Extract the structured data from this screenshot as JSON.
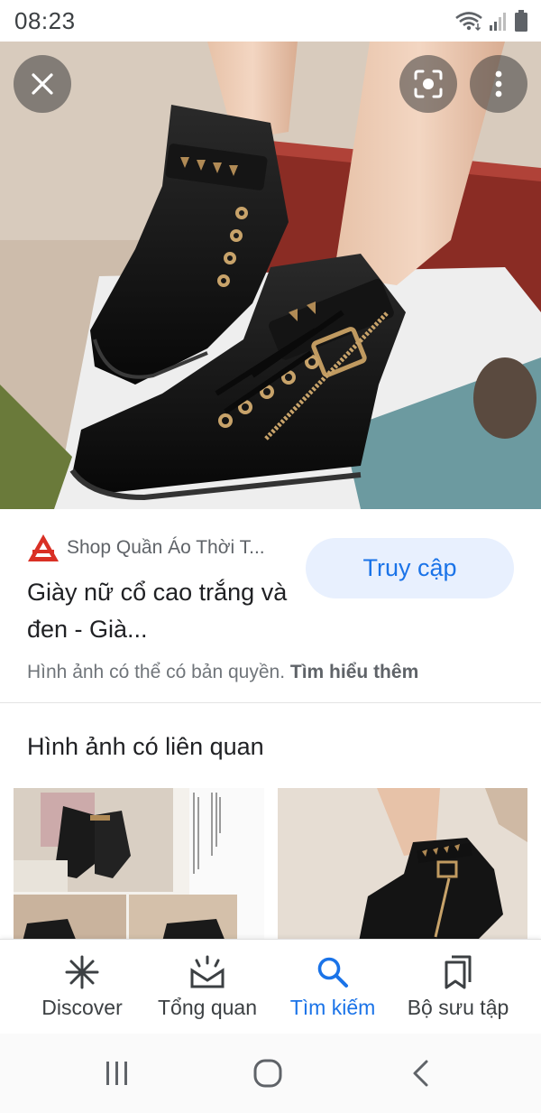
{
  "status_bar": {
    "time": "08:23"
  },
  "viewer": {
    "close_icon": "close-icon",
    "lens_icon": "lens-icon",
    "more_icon": "more-vert-icon"
  },
  "result": {
    "source_name": "Shop Quần Áo Thời T...",
    "title": "Giày nữ cổ cao trắng và đen - Già...",
    "visit_label": "Truy cập",
    "copyright_text": "Hình ảnh có thể có bản quyền.",
    "learn_more": "Tìm hiểu thêm"
  },
  "related": {
    "heading": "Hình ảnh có liên quan"
  },
  "bottom_nav": {
    "items": [
      {
        "label": "Discover",
        "icon": "asterisk-icon",
        "active": false
      },
      {
        "label": "Tổng quan",
        "icon": "updates-icon",
        "active": false
      },
      {
        "label": "Tìm kiếm",
        "icon": "search-icon",
        "active": true
      },
      {
        "label": "Bộ sưu tập",
        "icon": "collections-icon",
        "active": false
      }
    ]
  },
  "system_nav": {
    "recents": "recents-icon",
    "home": "home-icon",
    "back": "back-icon"
  },
  "colors": {
    "accent": "#1a73e8",
    "accent_bg": "#e8f0fe",
    "text_secondary": "#5f6368"
  }
}
